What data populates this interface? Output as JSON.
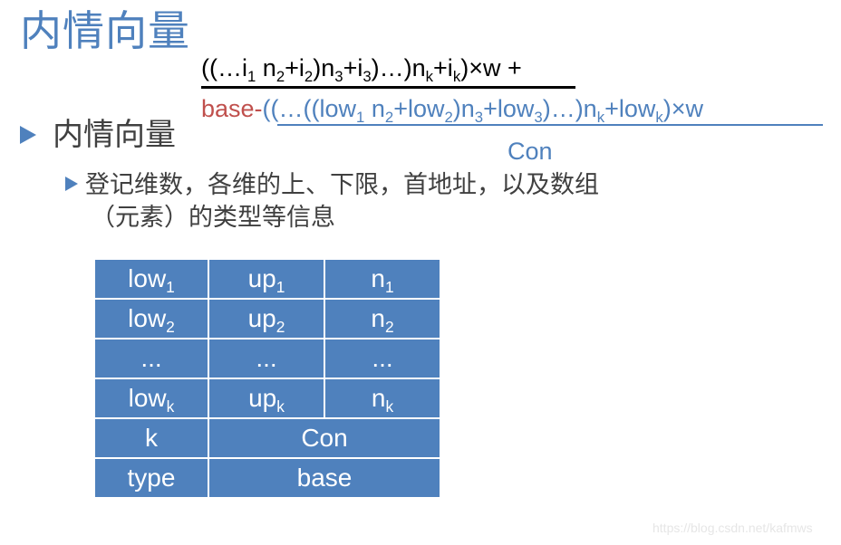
{
  "title": "内情向量",
  "formula": {
    "numerator": {
      "parts": [
        "((…i",
        "1",
        " n",
        "2",
        "+i",
        "2",
        ")n",
        "3",
        "+i",
        "3",
        ")…)n",
        "k",
        "+i",
        "k",
        ")",
        "×",
        "w +"
      ]
    },
    "base_prefix": "base-",
    "blue_expr": {
      "parts": [
        "((…((low",
        "1",
        " n",
        "2",
        "+low",
        "2",
        ")n",
        "3",
        "+low",
        "3",
        ")…)n",
        "k",
        "+low",
        "k",
        ")",
        "×",
        "w"
      ]
    },
    "denominator": "Con"
  },
  "bullets": {
    "level1": "内情向量",
    "level2_line1": "登记维数，各维的上、下限，首地址，以及数组",
    "level2_line2": "（元素）的类型等信息"
  },
  "table": {
    "rows": [
      [
        {
          "base": "low",
          "sub": "1"
        },
        {
          "base": "up",
          "sub": "1"
        },
        {
          "base": "n",
          "sub": "1"
        }
      ],
      [
        {
          "base": "low",
          "sub": "2"
        },
        {
          "base": "up",
          "sub": "2"
        },
        {
          "base": "n",
          "sub": "2"
        }
      ],
      [
        {
          "base": "...",
          "sub": ""
        },
        {
          "base": "...",
          "sub": ""
        },
        {
          "base": "...",
          "sub": ""
        }
      ],
      [
        {
          "base": "low",
          "sub": "k"
        },
        {
          "base": "up",
          "sub": "k"
        },
        {
          "base": "n",
          "sub": "k"
        }
      ],
      [
        {
          "base": "k",
          "sub": ""
        },
        {
          "base": "Con",
          "sub": "",
          "span": 2
        }
      ],
      [
        {
          "base": "type",
          "sub": ""
        },
        {
          "base": "base",
          "sub": "",
          "span": 2
        }
      ]
    ]
  },
  "colors": {
    "accent_blue": "#4f81bd",
    "base_red": "#c0504d",
    "text_gray": "#404040"
  },
  "watermark": "https://blog.csdn.net/kafmws"
}
